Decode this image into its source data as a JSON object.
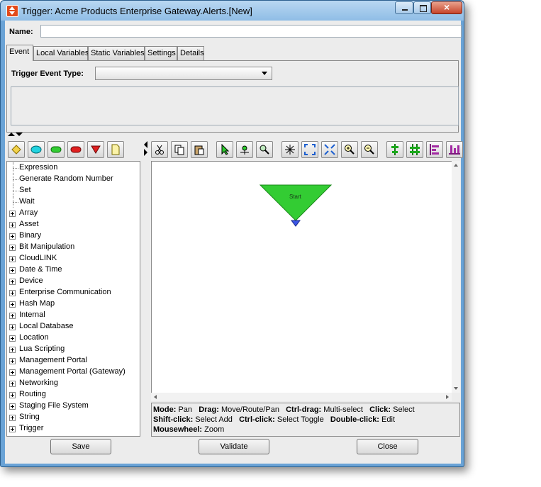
{
  "window": {
    "title": "Trigger:  Acme Products Enterprise Gateway.Alerts.[New]"
  },
  "form": {
    "name_label": "Name:",
    "name_value": ""
  },
  "tabs": [
    "Event",
    "Local Variables",
    "Static Variables",
    "Settings",
    "Details"
  ],
  "event_tab": {
    "trigger_event_type_label": "Trigger Event Type:",
    "trigger_event_type_value": ""
  },
  "shape_palette": [
    "diamond",
    "ellipse",
    "rounded-rect-green",
    "rounded-rect-red",
    "triangle-down",
    "document"
  ],
  "tree": {
    "items": [
      {
        "label": "Expression",
        "expandable": false
      },
      {
        "label": "Generate Random Number",
        "expandable": false
      },
      {
        "label": "Set",
        "expandable": false
      },
      {
        "label": "Wait",
        "expandable": false
      },
      {
        "label": "Array",
        "expandable": true
      },
      {
        "label": "Asset",
        "expandable": true
      },
      {
        "label": "Binary",
        "expandable": true
      },
      {
        "label": "Bit Manipulation",
        "expandable": true
      },
      {
        "label": "CloudLINK",
        "expandable": true
      },
      {
        "label": "Date & Time",
        "expandable": true
      },
      {
        "label": "Device",
        "expandable": true
      },
      {
        "label": "Enterprise Communication",
        "expandable": true
      },
      {
        "label": "Hash Map",
        "expandable": true
      },
      {
        "label": "Internal",
        "expandable": true
      },
      {
        "label": "Local Database",
        "expandable": true
      },
      {
        "label": "Location",
        "expandable": true
      },
      {
        "label": "Lua Scripting",
        "expandable": true
      },
      {
        "label": "Management Portal",
        "expandable": true
      },
      {
        "label": "Management Portal (Gateway)",
        "expandable": true
      },
      {
        "label": "Networking",
        "expandable": true
      },
      {
        "label": "Routing",
        "expandable": true
      },
      {
        "label": "Staging File System",
        "expandable": true
      },
      {
        "label": "String",
        "expandable": true
      },
      {
        "label": "Trigger",
        "expandable": true
      }
    ]
  },
  "toolbar": [
    "cut-icon",
    "copy-icon",
    "paste-icon",
    "select-pointer-icon",
    "route-icon",
    "pan-zoom-icon",
    "magic-select-icon",
    "fit-to-window-icon",
    "shrink-icon",
    "zoom-in-icon",
    "zoom-out-icon",
    "align-center-icon",
    "align-grid-icon",
    "align-left-icon",
    "align-bottom-icon"
  ],
  "canvas": {
    "start_node_label": "Start",
    "start_color": "#33cc33"
  },
  "help": {
    "mode_k": "Mode:",
    "mode_v": "Pan",
    "drag_k": "Drag:",
    "drag_v": "Move/Route/Pan",
    "ctrldrag_k": "Ctrl-drag:",
    "ctrldrag_v": "Multi-select",
    "click_k": "Click:",
    "click_v": "Select",
    "shiftclick_k": "Shift-click:",
    "shiftclick_v": "Select Add",
    "ctrlclick_k": "Ctrl-click:",
    "ctrlclick_v": "Select Toggle",
    "dblclick_k": "Double-click:",
    "dblclick_v": "Edit",
    "wheel_k": "Mousewheel:",
    "wheel_v": "Zoom"
  },
  "buttons": {
    "save": "Save",
    "validate": "Validate",
    "close": "Close"
  }
}
